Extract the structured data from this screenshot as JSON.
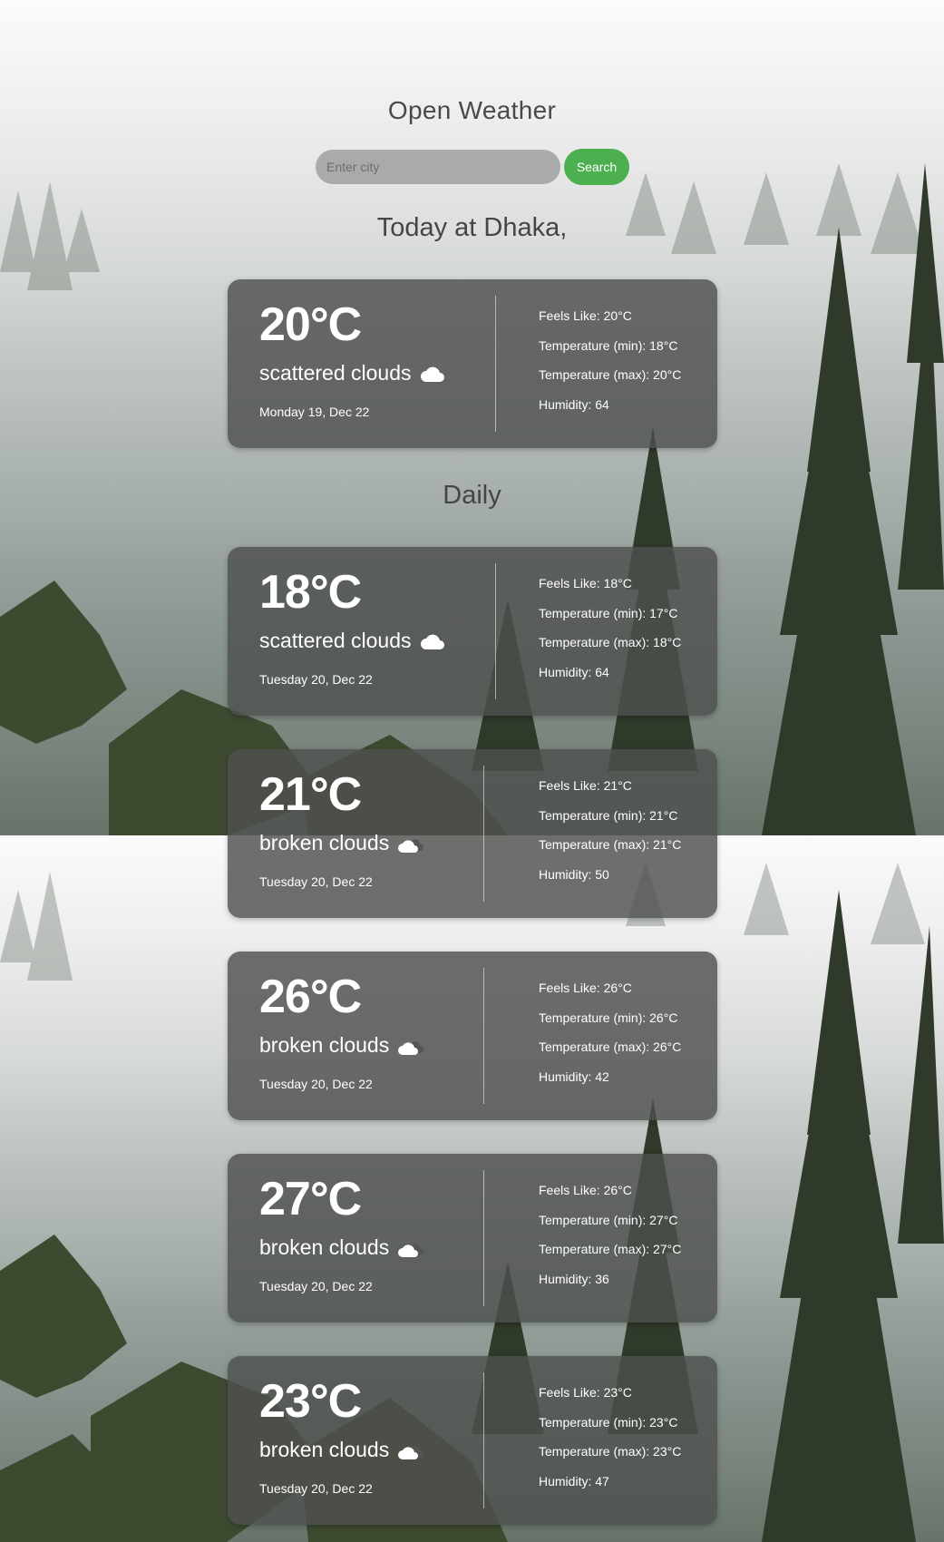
{
  "app": {
    "title": "Open Weather"
  },
  "search": {
    "placeholder": "Enter city",
    "value": "",
    "button_label": "Search"
  },
  "today": {
    "heading": "Today at Dhaka,",
    "card": {
      "temp": "20°C",
      "description": "scattered clouds",
      "icon": "cloud-icon",
      "date": "Monday 19, Dec 22",
      "feels_like": "Feels Like: 20°C",
      "temp_min": "Temperature (min): 18°C",
      "temp_max": "Temperature (max): 20°C",
      "humidity": "Humidity: 64"
    }
  },
  "daily": {
    "heading": "Daily",
    "cards": [
      {
        "temp": "18°C",
        "description": "scattered clouds",
        "icon": "cloud-icon",
        "date": "Tuesday 20, Dec 22",
        "feels_like": "Feels Like: 18°C",
        "temp_min": "Temperature (min): 17°C",
        "temp_max": "Temperature (max): 18°C",
        "humidity": "Humidity: 64"
      },
      {
        "temp": "21°C",
        "description": "broken clouds",
        "icon": "broken-clouds-icon",
        "date": "Tuesday 20, Dec 22",
        "feels_like": "Feels Like: 21°C",
        "temp_min": "Temperature (min): 21°C",
        "temp_max": "Temperature (max): 21°C",
        "humidity": "Humidity: 50"
      },
      {
        "temp": "26°C",
        "description": "broken clouds",
        "icon": "broken-clouds-icon",
        "date": "Tuesday 20, Dec 22",
        "feels_like": "Feels Like: 26°C",
        "temp_min": "Temperature (min): 26°C",
        "temp_max": "Temperature (max): 26°C",
        "humidity": "Humidity: 42"
      },
      {
        "temp": "27°C",
        "description": "broken clouds",
        "icon": "broken-clouds-icon",
        "date": "Tuesday 20, Dec 22",
        "feels_like": "Feels Like: 26°C",
        "temp_min": "Temperature (min): 27°C",
        "temp_max": "Temperature (max): 27°C",
        "humidity": "Humidity: 36"
      },
      {
        "temp": "23°C",
        "description": "broken clouds",
        "icon": "broken-clouds-icon",
        "date": "Tuesday 20, Dec 22",
        "feels_like": "Feels Like: 23°C",
        "temp_min": "Temperature (min): 23°C",
        "temp_max": "Temperature (max): 23°C",
        "humidity": "Humidity: 47"
      }
    ]
  },
  "colors": {
    "search_button": "#4caf50",
    "card_background": "#4e504e",
    "title_text": "#4a4a4a"
  }
}
